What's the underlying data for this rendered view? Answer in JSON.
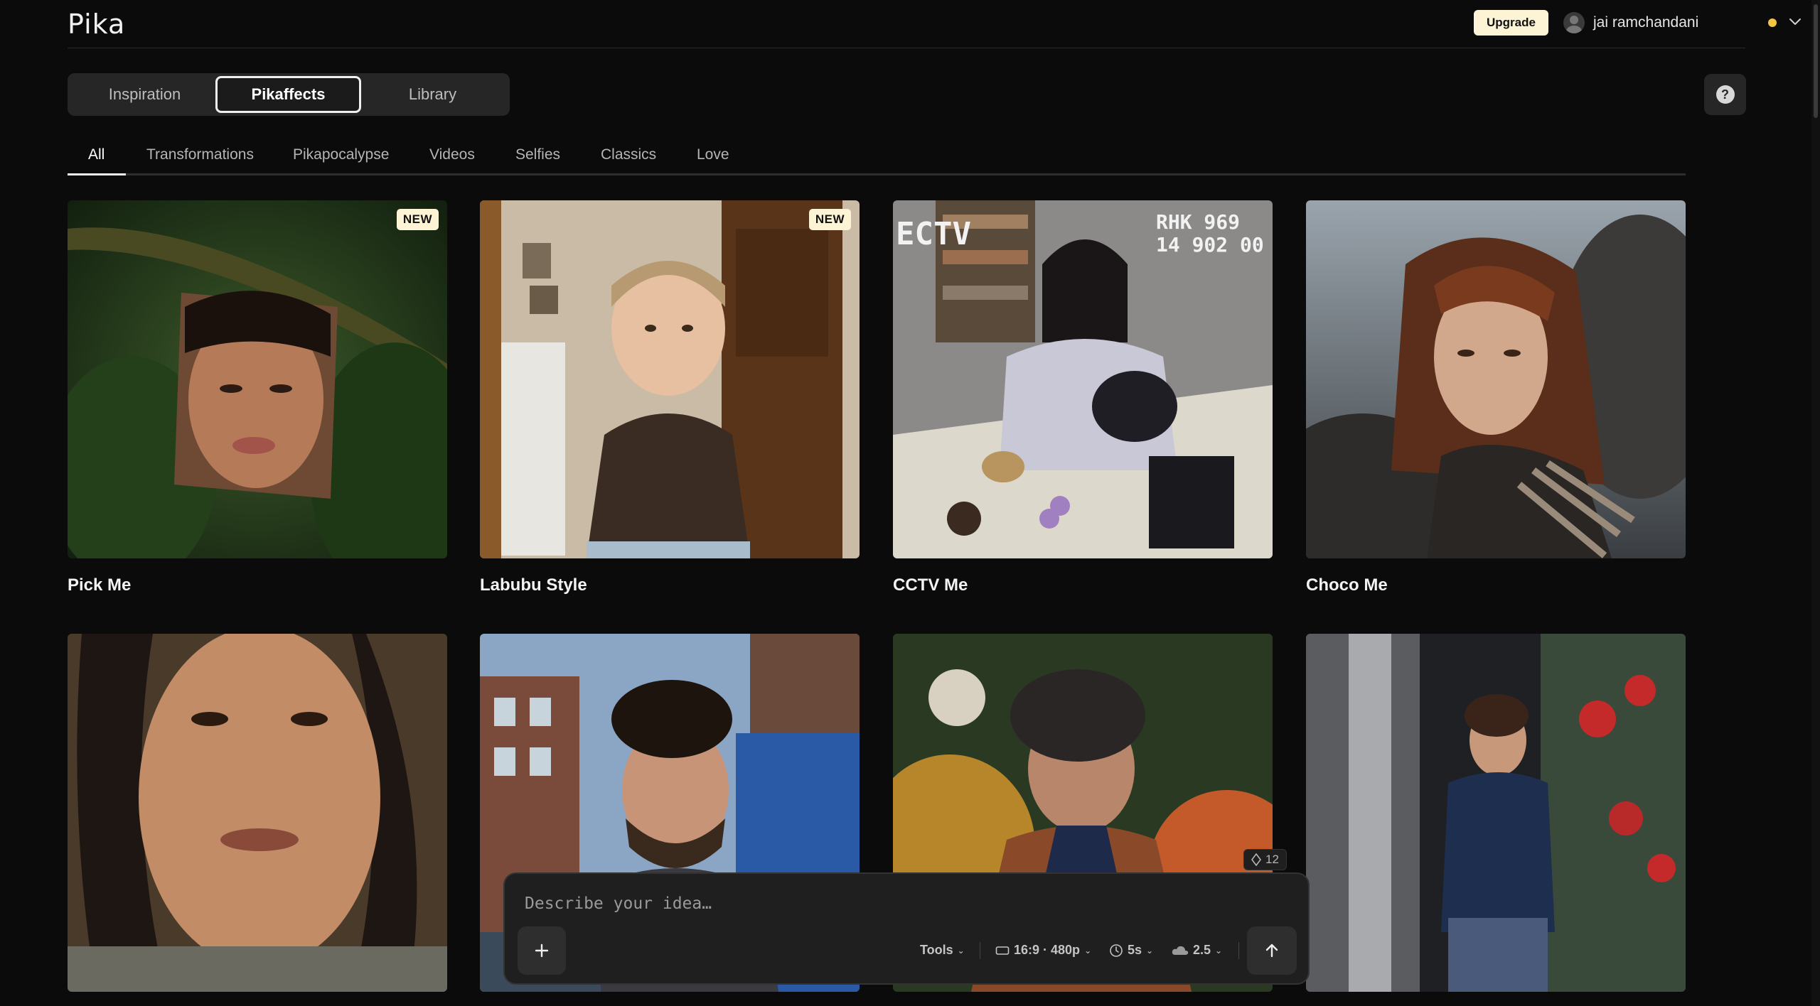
{
  "app": {
    "logo": "Pika"
  },
  "header": {
    "upgrade_label": "Upgrade",
    "user_name": "jai ramchandani",
    "status_color": "#f4c542"
  },
  "main_tabs": [
    {
      "label": "Inspiration",
      "active": false
    },
    {
      "label": "Pikaffects",
      "active": true
    },
    {
      "label": "Library",
      "active": false
    }
  ],
  "help_label": "?",
  "categories": [
    {
      "label": "All",
      "active": true
    },
    {
      "label": "Transformations",
      "active": false
    },
    {
      "label": "Pikapocalypse",
      "active": false
    },
    {
      "label": "Videos",
      "active": false
    },
    {
      "label": "Selfies",
      "active": false
    },
    {
      "label": "Classics",
      "active": false
    },
    {
      "label": "Love",
      "active": false
    }
  ],
  "cards": [
    {
      "title": "Pick Me",
      "badge": "NEW"
    },
    {
      "title": "Labubu Style",
      "badge": "NEW"
    },
    {
      "title": "CCTV Me",
      "badge": ""
    },
    {
      "title": "Choco Me",
      "badge": ""
    },
    {
      "title": "",
      "badge": ""
    },
    {
      "title": "",
      "badge": ""
    },
    {
      "title": "",
      "badge": ""
    },
    {
      "title": "",
      "badge": ""
    }
  ],
  "cctv_overlay": {
    "left_text": "ECTV",
    "right_text": "RHK 969",
    "time_text": "14 902 00"
  },
  "prompt": {
    "placeholder": "Describe your idea…",
    "credits": "12",
    "tools_label": "Tools",
    "aspect_label": "16:9 · 480p",
    "duration_label": "5s",
    "model_label": "2.5"
  },
  "icons": {
    "user": "user-avatar-icon",
    "chevron": "chevron-down-icon",
    "help": "question-icon",
    "plus": "plus-icon",
    "send": "arrow-up-icon",
    "aspect": "aspect-ratio-icon",
    "clock": "clock-icon",
    "cloud": "cloud-icon",
    "credits": "diamond-icon"
  }
}
